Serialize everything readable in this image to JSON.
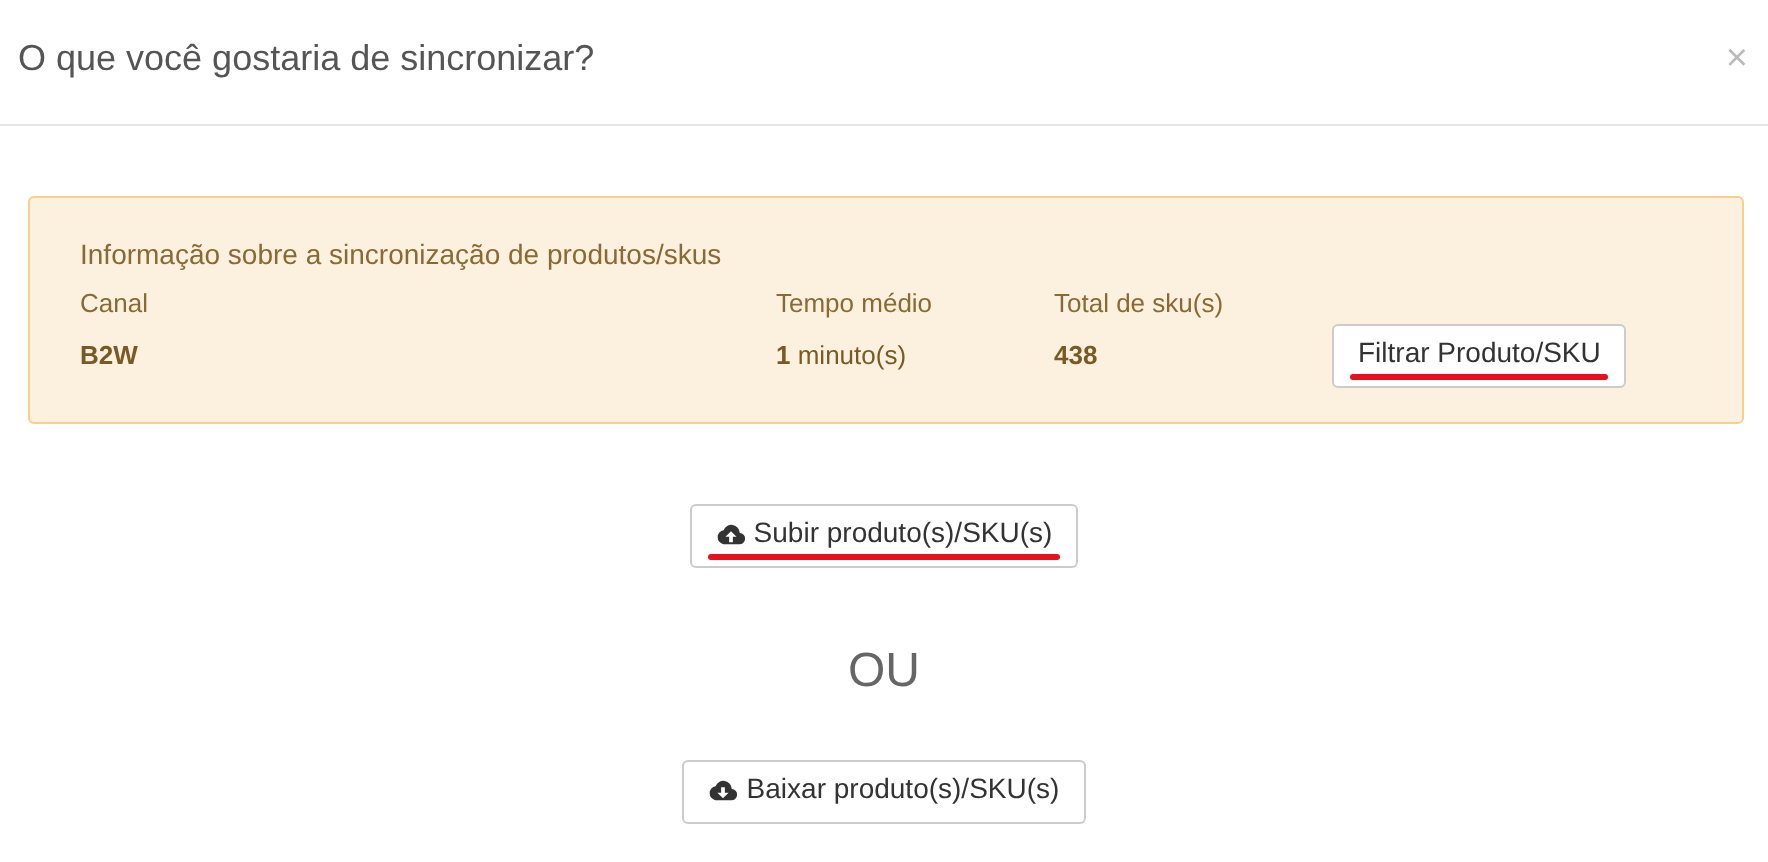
{
  "dialog": {
    "title": "O que você gostaria de sincronizar?",
    "close": "×"
  },
  "info": {
    "heading": "Informação sobre a sincronização de produtos/skus",
    "columns": [
      "Canal",
      "Tempo médio",
      "Total de sku(s)"
    ],
    "values": [
      "B2W",
      "**1** minuto(s)",
      "438"
    ],
    "button": {
      "label": "Filtrar Produto/SKU",
      "marked": true
    }
  },
  "actions": [
    {
      "kind": "upload",
      "label": "Subir produto(s)/SKU(s)",
      "marked": true
    },
    {
      "kind": "separator",
      "label": "OU"
    },
    {
      "kind": "download",
      "label": "Baixar produto(s)/SKU(s)",
      "marked": false
    }
  ]
}
